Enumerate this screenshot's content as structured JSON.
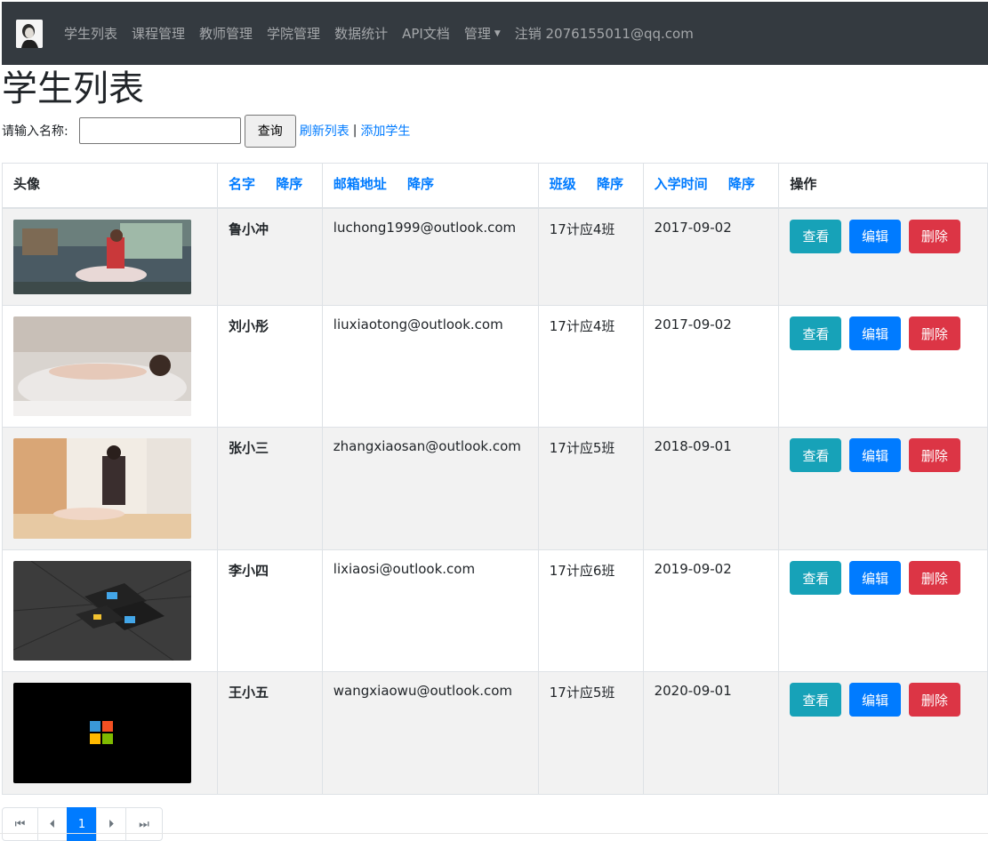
{
  "nav": {
    "items": [
      "学生列表",
      "课程管理",
      "教师管理",
      "学院管理",
      "数据统计",
      "API文档",
      "管理"
    ],
    "logout": "注销 2076155011@qq.com"
  },
  "page_title": "学生列表",
  "search": {
    "label": "请输入名称:",
    "value": "",
    "button": "查询",
    "refresh": "刷新列表",
    "separator": "|",
    "add": "添加学生"
  },
  "table": {
    "headers": {
      "avatar": "头像",
      "name": "名字",
      "email": "邮箱地址",
      "class": "班级",
      "enroll": "入学时间",
      "actions": "操作",
      "sort": "降序"
    },
    "rows": [
      {
        "name": "鲁小冲",
        "email": "luchong1999@outlook.com",
        "class": "17计应4班",
        "enroll": "2017-09-02"
      },
      {
        "name": "刘小彤",
        "email": "liuxiaotong@outlook.com",
        "class": "17计应4班",
        "enroll": "2017-09-02"
      },
      {
        "name": "张小三",
        "email": "zhangxiaosan@outlook.com",
        "class": "17计应5班",
        "enroll": "2018-09-01"
      },
      {
        "name": "李小四",
        "email": "lixiaosi@outlook.com",
        "class": "17计应6班",
        "enroll": "2019-09-02"
      },
      {
        "name": "王小五",
        "email": "wangxiaowu@outlook.com",
        "class": "17计应5班",
        "enroll": "2020-09-01"
      }
    ],
    "buttons": {
      "view": "查看",
      "edit": "编辑",
      "delete": "删除"
    }
  },
  "pagination": {
    "first": "⏮",
    "prev": "⏴",
    "current": "1",
    "next": "⏵",
    "last": "⏭"
  },
  "colors": {
    "navbar": "#343a40",
    "link": "#007bff",
    "info": "#17a2b8",
    "primary": "#007bff",
    "danger": "#dc3545"
  }
}
